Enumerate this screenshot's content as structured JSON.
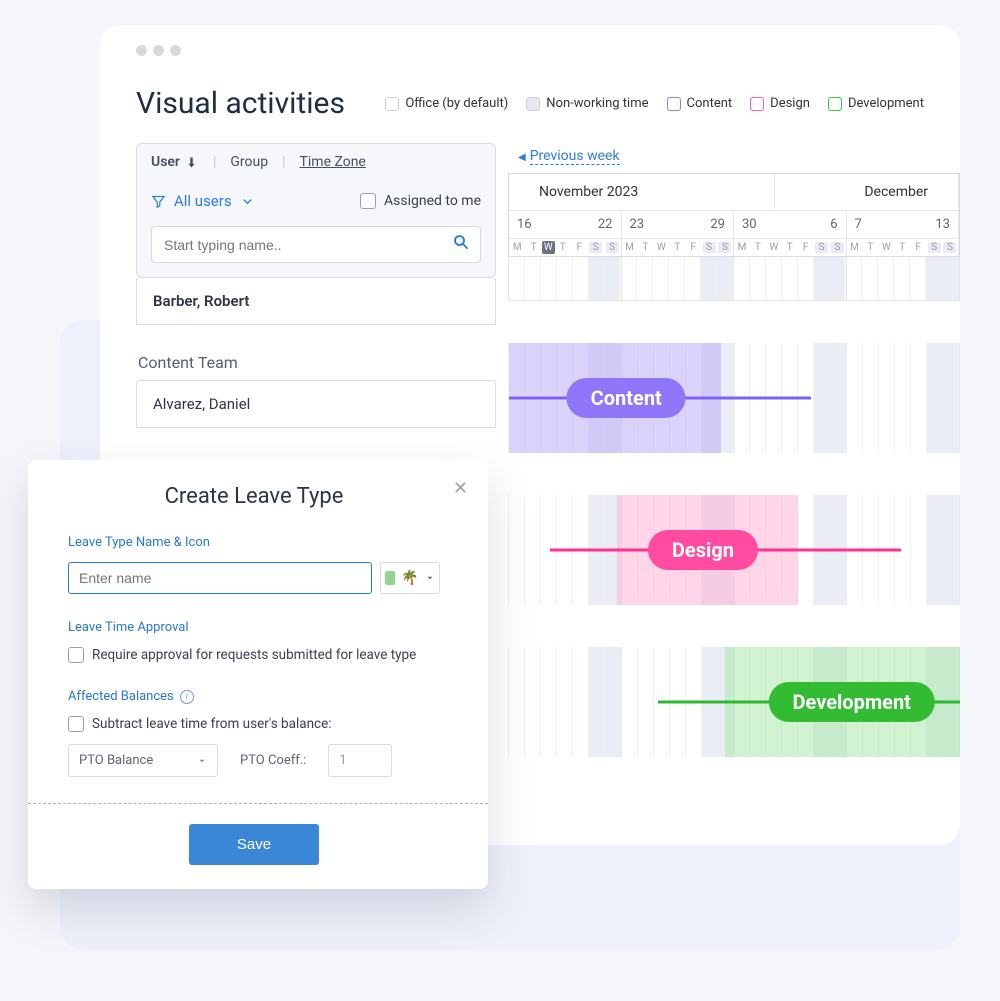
{
  "page": {
    "title": "Visual activities"
  },
  "legend": [
    {
      "label": "Office (by default)",
      "cls": ""
    },
    {
      "label": "Non-working time",
      "cls": "nonworking"
    },
    {
      "label": "Content",
      "cls": "content"
    },
    {
      "label": "Design",
      "cls": "design"
    },
    {
      "label": "Development",
      "cls": "development"
    }
  ],
  "filter": {
    "tab_user": "User",
    "tab_group": "Group",
    "tab_tz": "Time Zone",
    "all_users": "All users",
    "assigned": "Assigned to me",
    "search_placeholder": "Start typing name.."
  },
  "users": {
    "row0": "Barber, Robert",
    "team_title": "Content Team",
    "team_row0": "Alvarez, Daniel"
  },
  "calendar": {
    "prev_week": "Previous week",
    "months": [
      "November 2023",
      "December"
    ],
    "week_starts": [
      "16",
      "22",
      "23",
      "29",
      "30",
      "6",
      "7",
      "13"
    ],
    "day_letters": [
      "M",
      "T",
      "W",
      "T",
      "F",
      "S",
      "S"
    ]
  },
  "tracks": {
    "content": "Content",
    "design": "Design",
    "development": "Development"
  },
  "modal": {
    "title": "Create Leave Type",
    "sec_name": "Leave Type Name & Icon",
    "name_placeholder": "Enter name",
    "sec_approval": "Leave Time Approval",
    "approval_chk": "Require approval for requests submitted for leave type",
    "sec_balances": "Affected Balances",
    "balance_chk": "Subtract leave time from user's balance:",
    "select_value": "PTO Balance",
    "coeff_label": "PTO Coeff.:",
    "coeff_value": "1",
    "save": "Save"
  }
}
